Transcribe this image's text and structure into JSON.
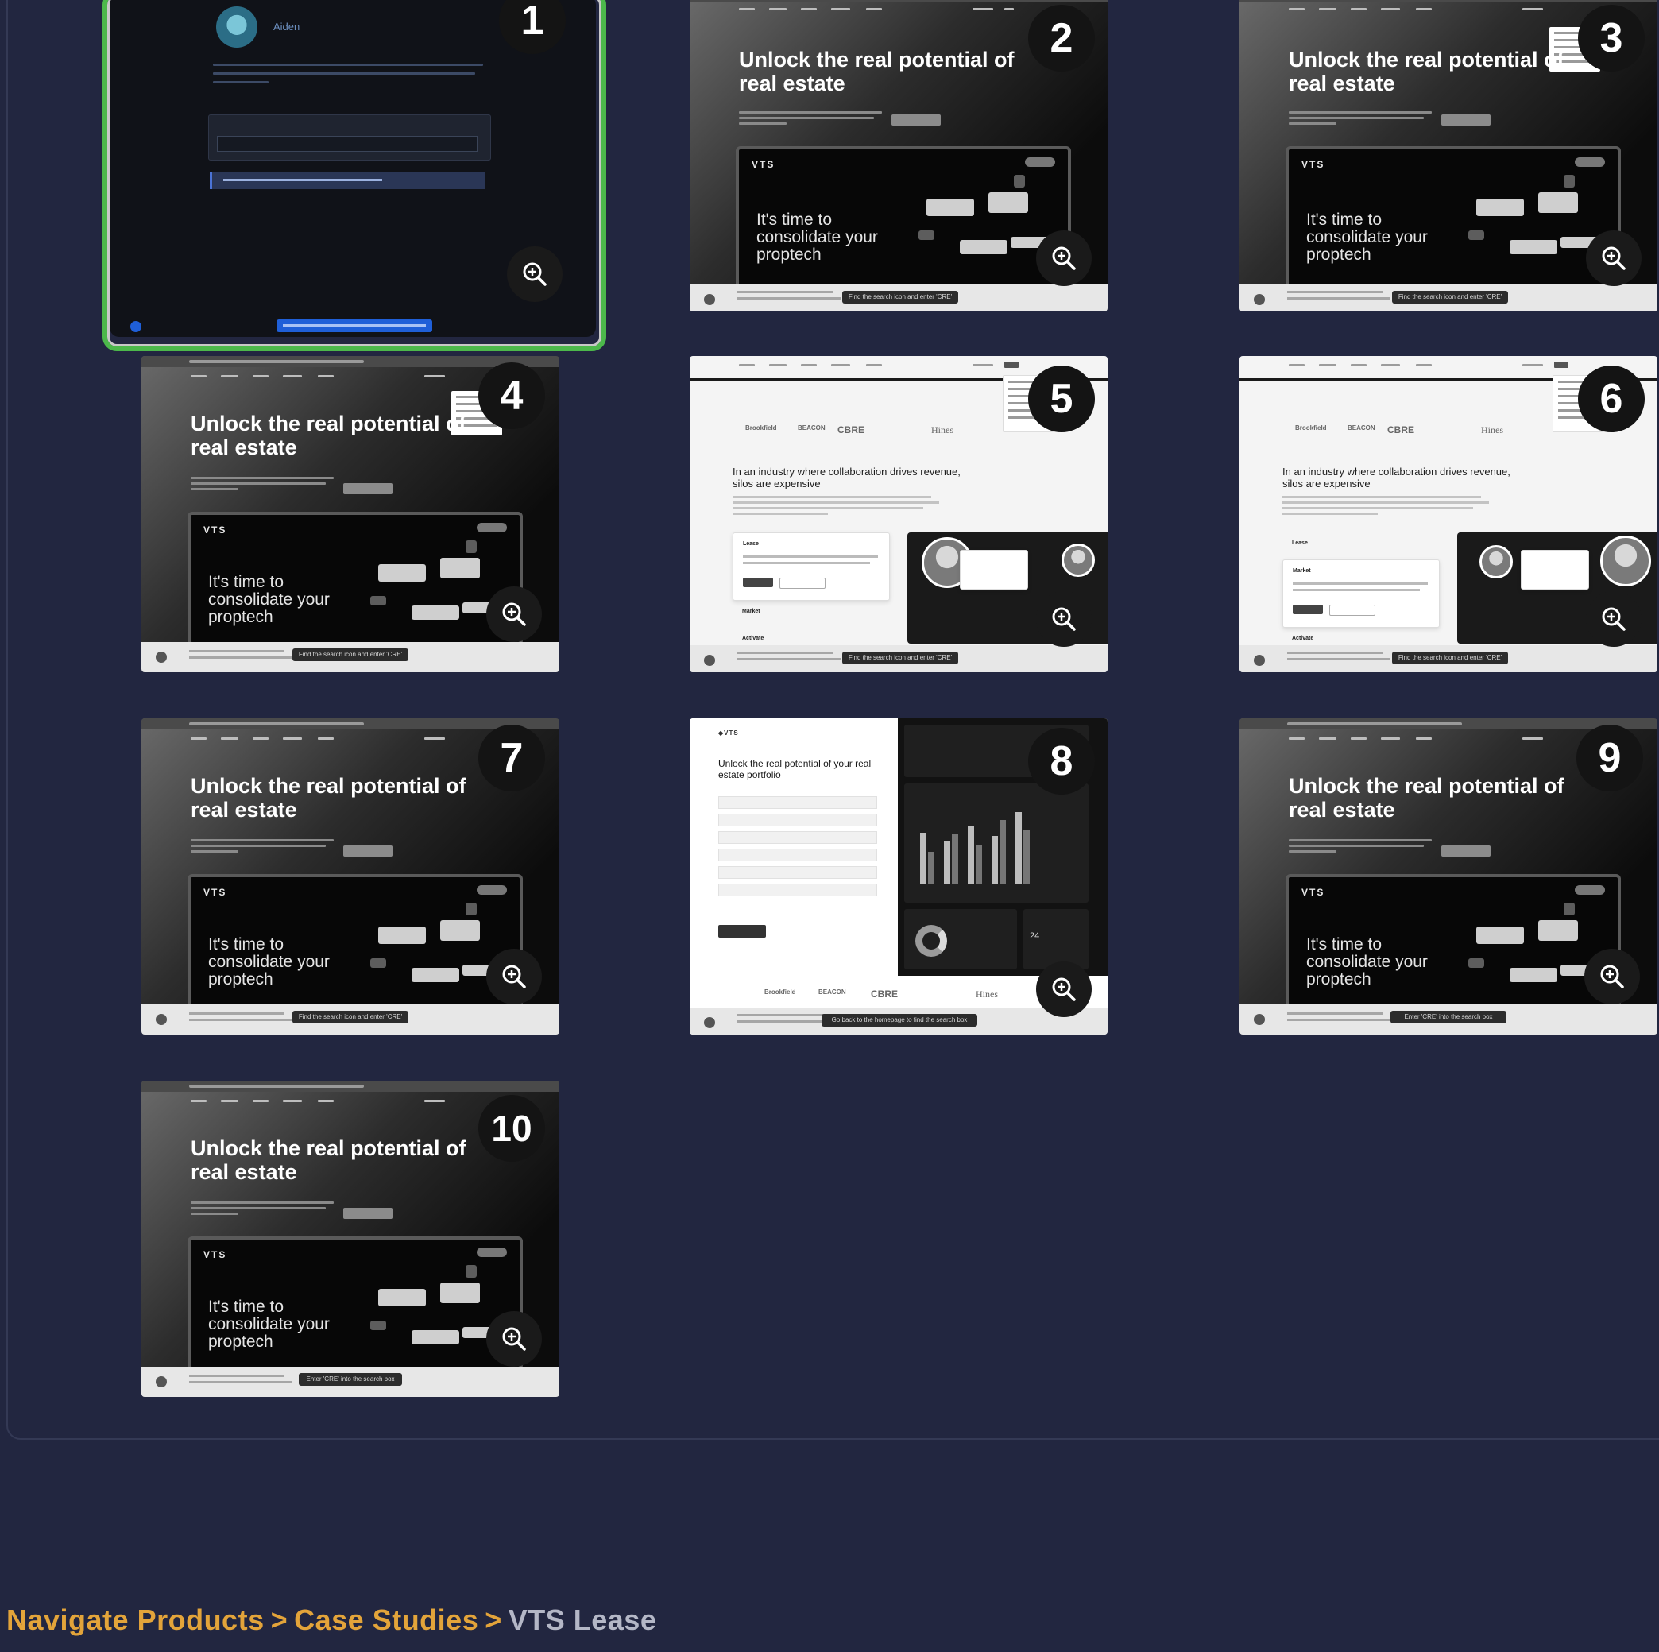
{
  "breadcrumb": {
    "items": [
      "Navigate Products",
      "Case Studies"
    ],
    "current": "VTS Lease",
    "separator": ">"
  },
  "selected_step": 1,
  "thumb1": {
    "user_name": "Aiden"
  },
  "steps": [
    {
      "number": "1"
    },
    {
      "number": "2",
      "hero_title": "Unlock the real potential of real estate",
      "inner_logo": "VTS",
      "inner_tagline": "It's time to consolidate your proptech",
      "tooltip": "Find the search icon and enter 'CRE'"
    },
    {
      "number": "3",
      "hero_title": "Unlock the real potential of real estate",
      "inner_logo": "VTS",
      "inner_tagline": "It's time to consolidate your proptech",
      "tooltip": "Find the search icon and enter 'CRE'"
    },
    {
      "number": "4",
      "hero_title": "Unlock the real potential of real estate",
      "inner_logo": "VTS",
      "inner_tagline": "It's time to consolidate your proptech",
      "tooltip": "Find the search icon and enter 'CRE'"
    },
    {
      "number": "5",
      "logos": [
        "Brookfield",
        "BEACON",
        "CBRE",
        "Hines"
      ],
      "heading": "In an industry where collaboration drives revenue, silos are expensive",
      "accordion": [
        "Lease",
        "Market",
        "Activate"
      ],
      "tooltip": "Find the search icon and enter 'CRE'"
    },
    {
      "number": "6",
      "logos": [
        "Brookfield",
        "BEACON",
        "CBRE",
        "Hines"
      ],
      "heading": "In an industry where collaboration drives revenue, silos are expensive",
      "accordion": [
        "Lease",
        "Market",
        "Activate"
      ],
      "tooltip": "Find the search icon and enter 'CRE'"
    },
    {
      "number": "7",
      "hero_title": "Unlock the real potential of real estate",
      "inner_logo": "VTS",
      "inner_tagline": "It's time to consolidate your proptech",
      "tooltip": "Find the search icon and enter 'CRE'"
    },
    {
      "number": "8",
      "form_title": "Unlock the real potential of your real estate portfolio",
      "chart_card_value": "24",
      "logos": [
        "Brookfield",
        "BEACON",
        "CBRE",
        "Hines"
      ],
      "tooltip": "Go back to the homepage to find the search box"
    },
    {
      "number": "9",
      "hero_title": "Unlock the real potential of real estate",
      "inner_logo": "VTS",
      "inner_tagline": "It's time to consolidate your proptech",
      "tooltip": "Enter 'CRE' into the search box"
    },
    {
      "number": "10",
      "hero_title": "Unlock the real potential of real estate",
      "inner_logo": "VTS",
      "inner_tagline": "It's time to consolidate your proptech",
      "tooltip": "Enter 'CRE' into the search box"
    }
  ],
  "icons": {
    "zoom": "zoom-in-icon"
  },
  "colors": {
    "page_bg": "#222640",
    "breadcrumb_link": "#e3a43a",
    "breadcrumb_current": "#b4b7c6",
    "selected_border": "#4cb84b"
  }
}
